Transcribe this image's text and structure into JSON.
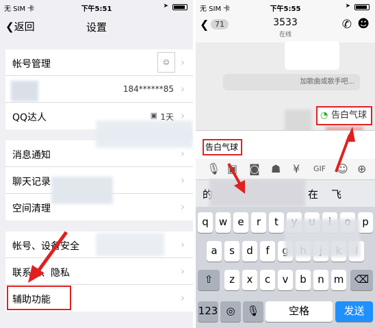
{
  "left": {
    "status": {
      "carrier": "无 SIM 卡",
      "time": "下午5:51"
    },
    "nav": {
      "back": "返回",
      "title": "设置"
    },
    "rows": {
      "account": "帐号管理",
      "phone_value": "184******85",
      "qq": "QQ达人",
      "qq_value": "1天",
      "notify": "消息通知",
      "chat": "聊天记录",
      "space": "空间清理",
      "security": "帐号、设备安全",
      "privacy": "联系人、隐私",
      "assist": "辅助功能"
    }
  },
  "right": {
    "status": {
      "carrier": "无 SIM 卡",
      "time": "下午5:55"
    },
    "nav": {
      "badge": "71",
      "name": "3533",
      "sub": "在线"
    },
    "hint": "加歌曲或歌手吧...",
    "suggest": "告白气球",
    "input": "告白气球",
    "cand": [
      "的",
      "在",
      "飞"
    ],
    "keys": {
      "row1": [
        "q",
        "w",
        "e",
        "r",
        "t",
        "y",
        "u",
        "i",
        "o",
        "p"
      ],
      "row2": [
        "a",
        "s",
        "d",
        "f",
        "g",
        "h",
        "j",
        "k",
        "l"
      ],
      "row3": [
        "z",
        "x",
        "c",
        "v",
        "b",
        "n",
        "m"
      ],
      "num": "123",
      "space": "空格",
      "send": "发送"
    }
  },
  "colors": {
    "highlight": "#e02020",
    "send": "#1e90ff"
  }
}
